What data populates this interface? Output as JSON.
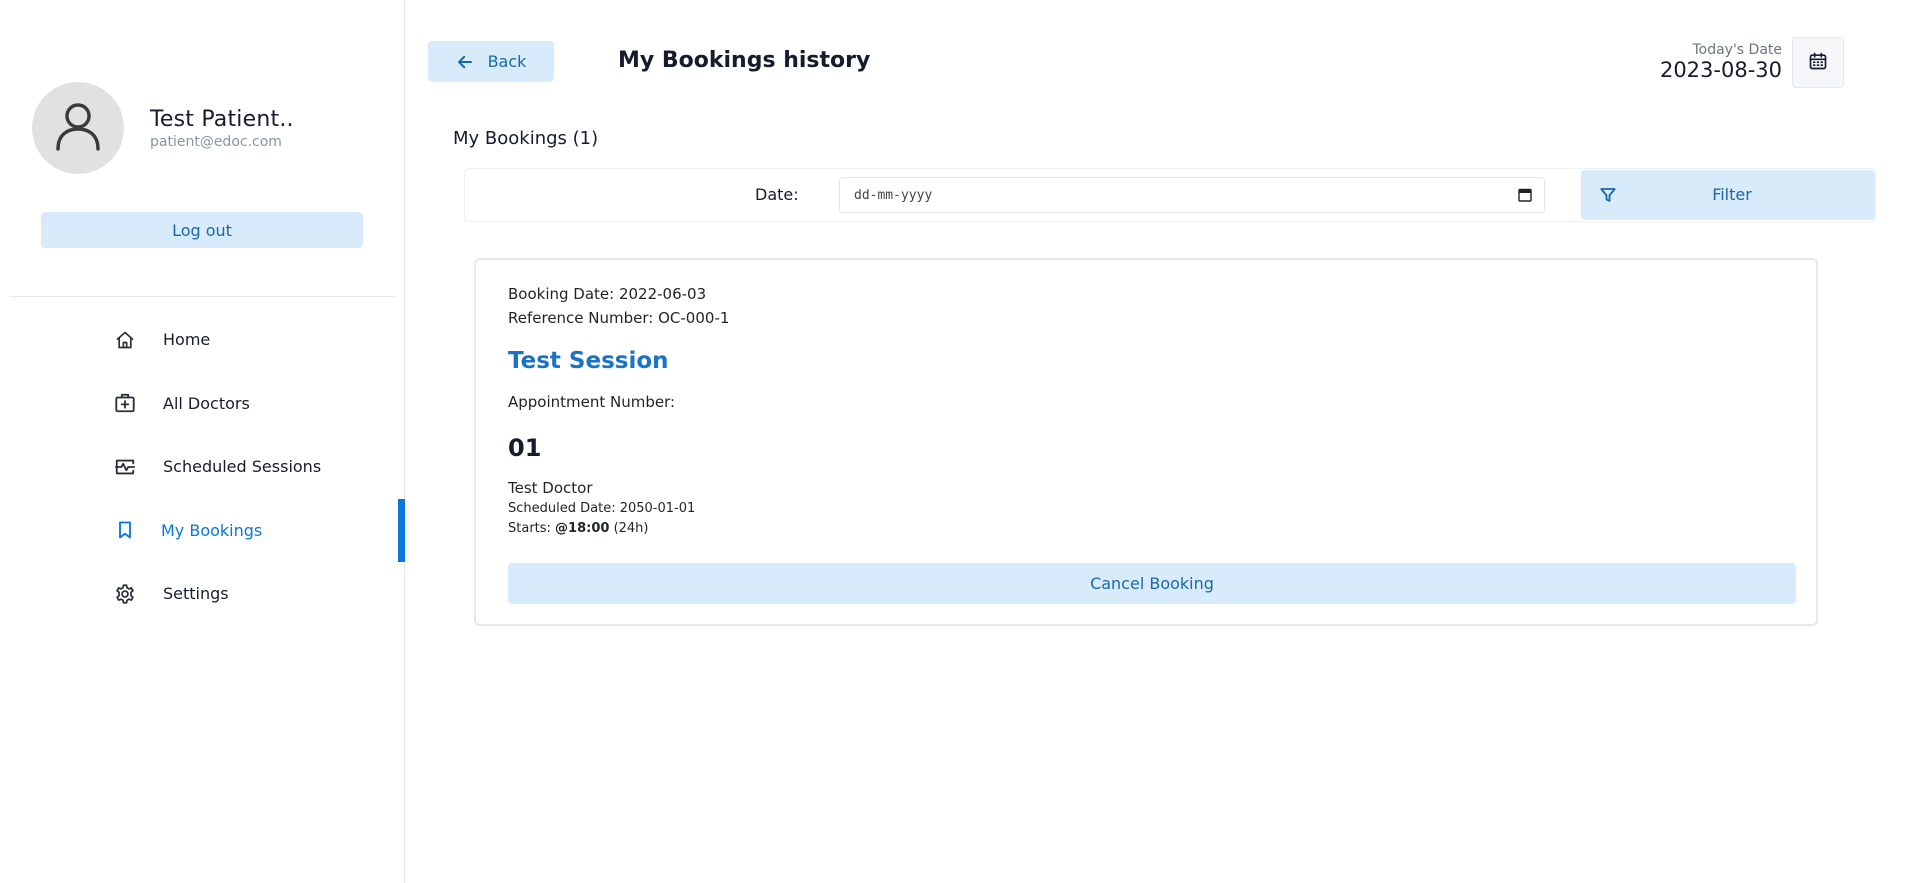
{
  "sidebar": {
    "profile": {
      "name": "Test Patient..",
      "email": "patient@edoc.com"
    },
    "logout_label": "Log out",
    "menu": [
      {
        "label": "Home",
        "icon": "home-icon"
      },
      {
        "label": "All Doctors",
        "icon": "medical-bag-icon"
      },
      {
        "label": "Scheduled Sessions",
        "icon": "session-monitor-icon"
      },
      {
        "label": "My Bookings",
        "icon": "bookmark-icon",
        "active": true
      },
      {
        "label": "Settings",
        "icon": "gear-icon"
      }
    ]
  },
  "header": {
    "back_label": "Back",
    "title": "My Bookings history",
    "today_label": "Today's Date",
    "today_value": "2023-08-30"
  },
  "section_title": "My Bookings (1)",
  "filter": {
    "date_label": "Date:",
    "date_placeholder": "dd-mm-yyyy",
    "filter_label": "Filter"
  },
  "booking": {
    "booking_date": "Booking Date: 2022-06-03",
    "reference": "Reference Number: OC-000-1",
    "session_title": "Test Session",
    "appointment_label": "Appointment Number:",
    "appointment_number": "01",
    "doctor": "Test Doctor",
    "scheduled_date": "Scheduled Date: 2050-01-01",
    "starts_prefix": "Starts: ",
    "starts_time": "@18:00",
    "starts_suffix": " (24h)",
    "cancel_label": "Cancel Booking"
  },
  "colors": {
    "accent": "#0a76d8",
    "button_bg": "#d8ebfa",
    "button_text": "#1969aa"
  }
}
